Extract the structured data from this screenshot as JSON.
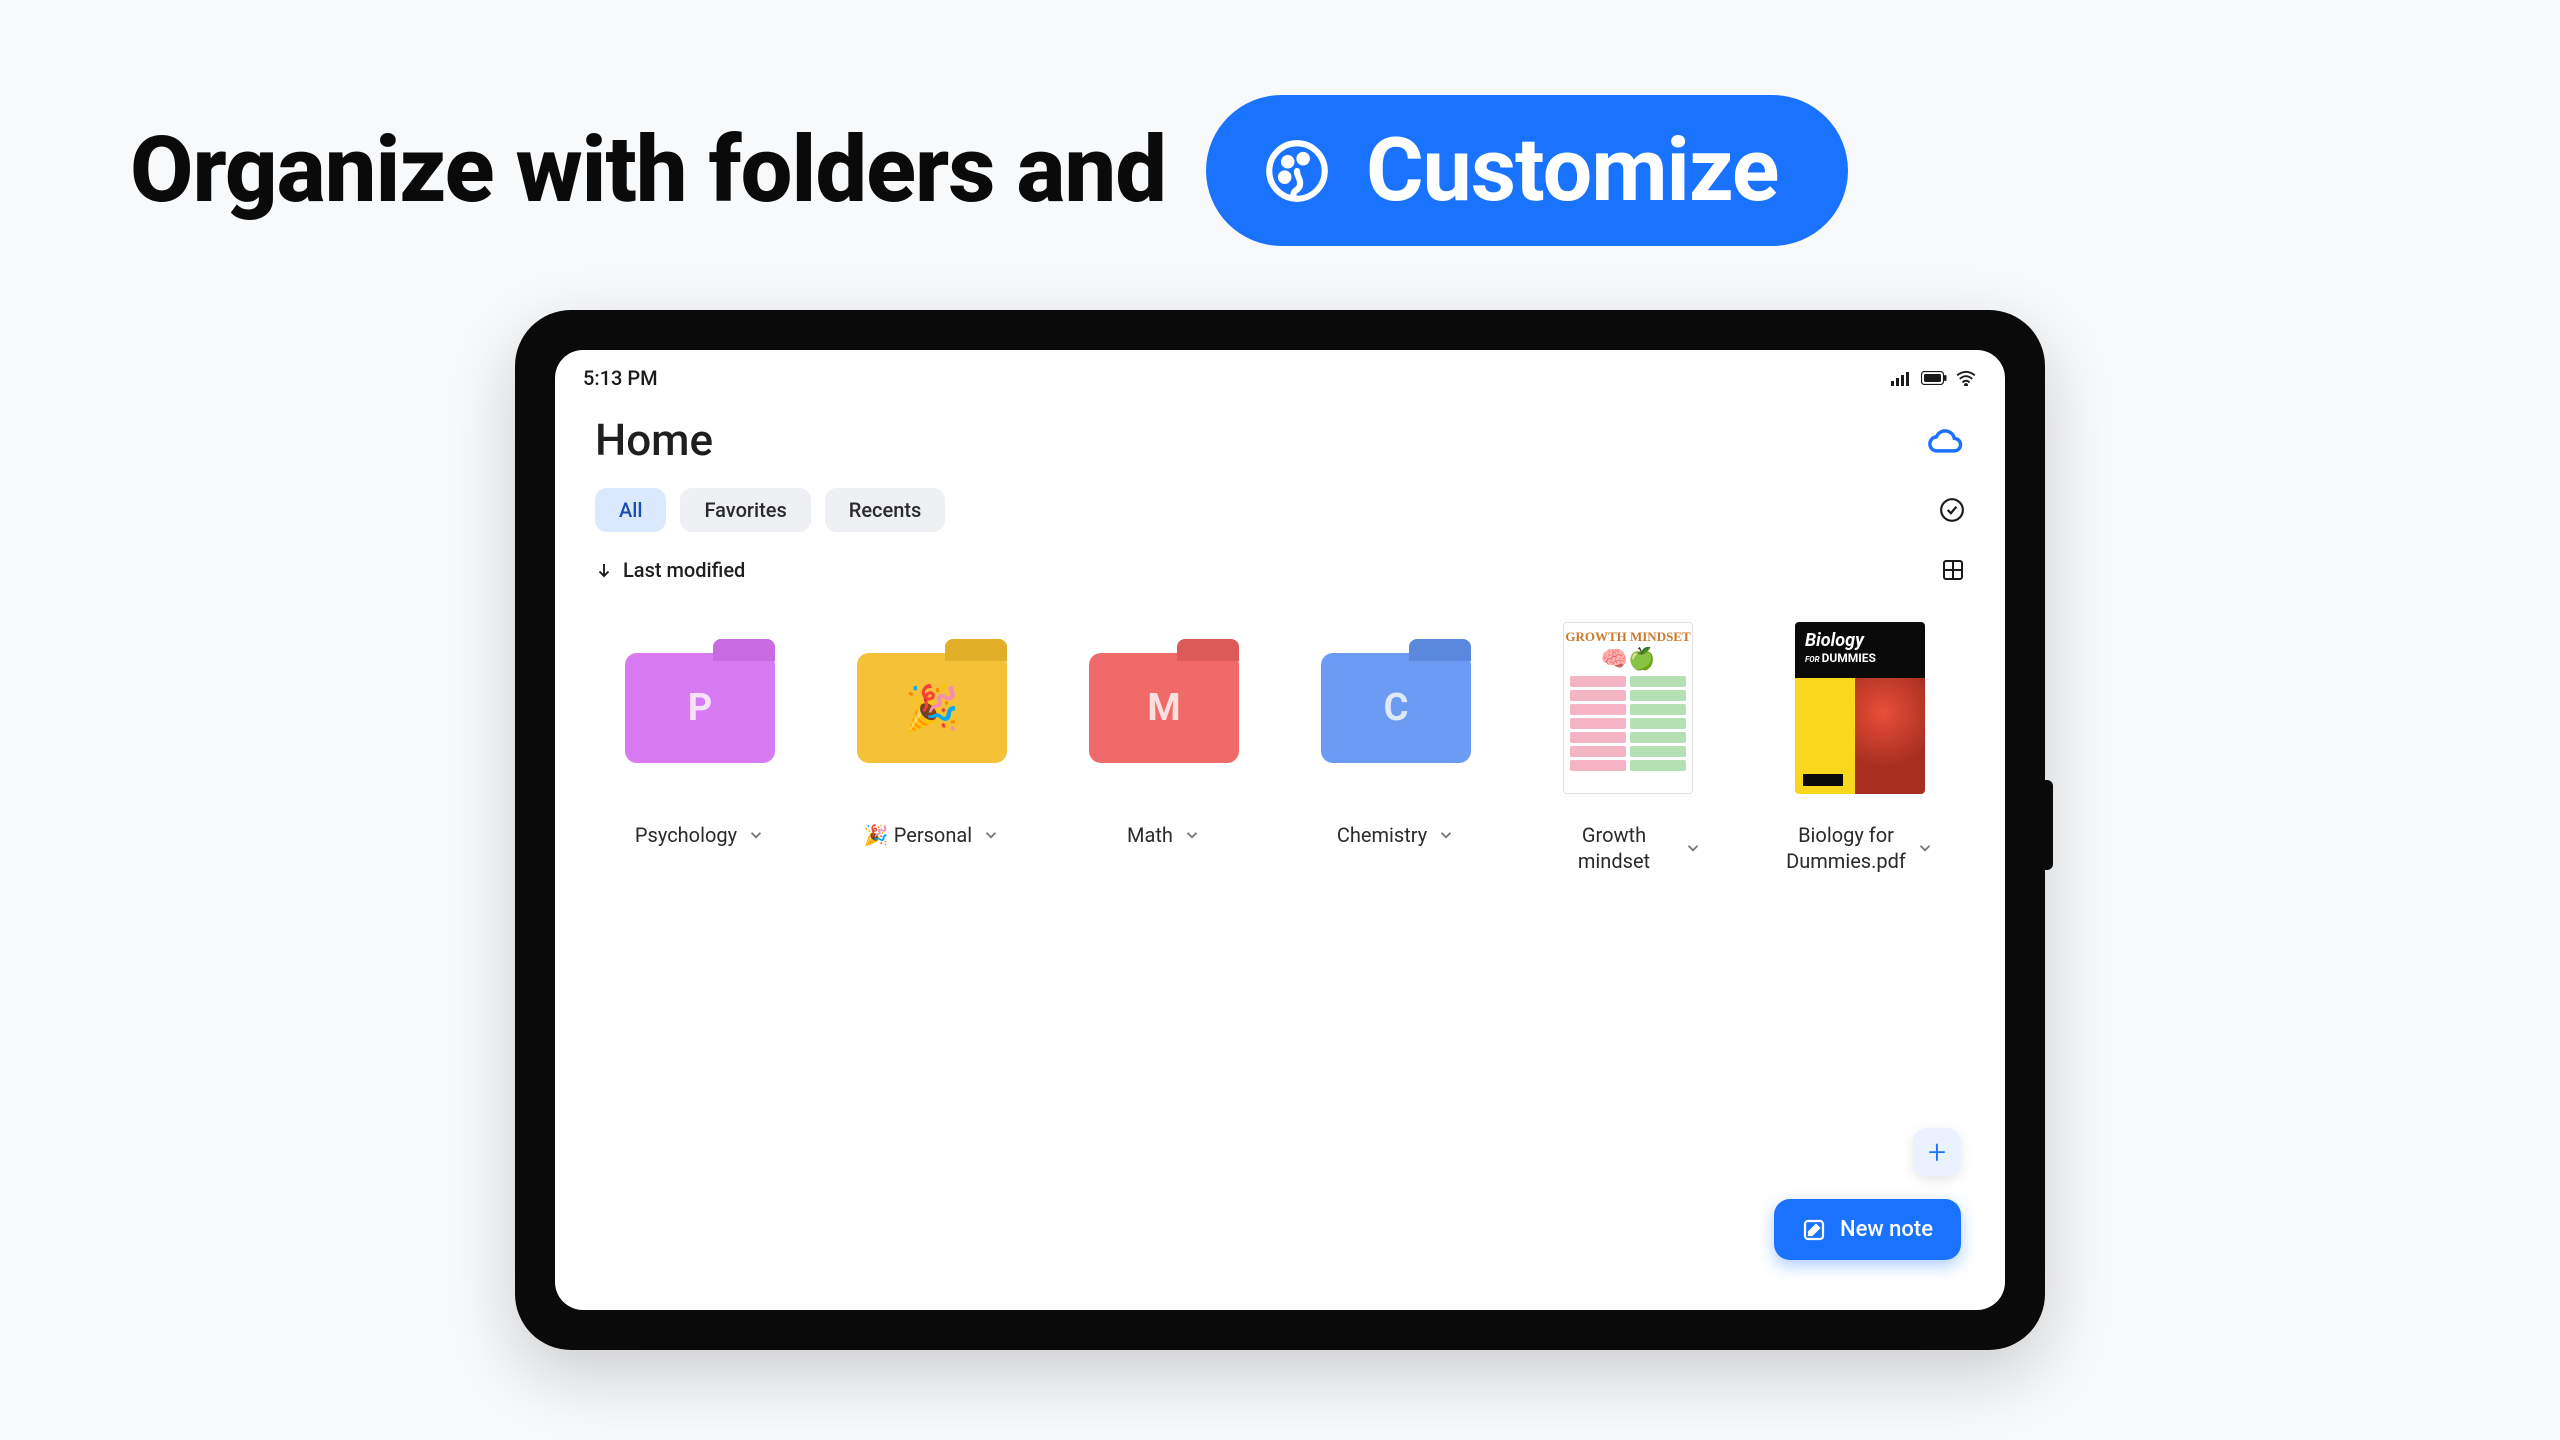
{
  "headline": {
    "text": "Organize with folders and",
    "pill_label": "Customize"
  },
  "statusbar": {
    "time": "5:13 PM"
  },
  "page": {
    "title": "Home"
  },
  "tabs": [
    {
      "label": "All",
      "active": true
    },
    {
      "label": "Favorites",
      "active": false
    },
    {
      "label": "Recents",
      "active": false
    }
  ],
  "sort": {
    "label": "Last modified"
  },
  "items": [
    {
      "type": "folder",
      "label": "Psychology",
      "letter": "P",
      "bg": "#d87bf2",
      "tab_bg": "#c96ae2"
    },
    {
      "type": "folder",
      "label": "🎉 Personal",
      "emoji": "🎉",
      "bg": "#f5c237",
      "tab_bg": "#e2af28"
    },
    {
      "type": "folder",
      "label": "Math",
      "letter": "M",
      "bg": "#f06a6a",
      "tab_bg": "#dc5a5a"
    },
    {
      "type": "folder",
      "label": "Chemistry",
      "letter": "C",
      "bg": "#6b9bf2",
      "tab_bg": "#5a88df"
    },
    {
      "type": "doc",
      "label": "Growth mindset",
      "doc_kind": "gm",
      "doc_title": "GROWTH MINDSET"
    },
    {
      "type": "doc",
      "label": "Biology for Dummies.pdf",
      "doc_kind": "bio",
      "bio_title": "Biology",
      "bio_sub": "DUMMIES"
    }
  ],
  "buttons": {
    "new_note": "New note"
  }
}
